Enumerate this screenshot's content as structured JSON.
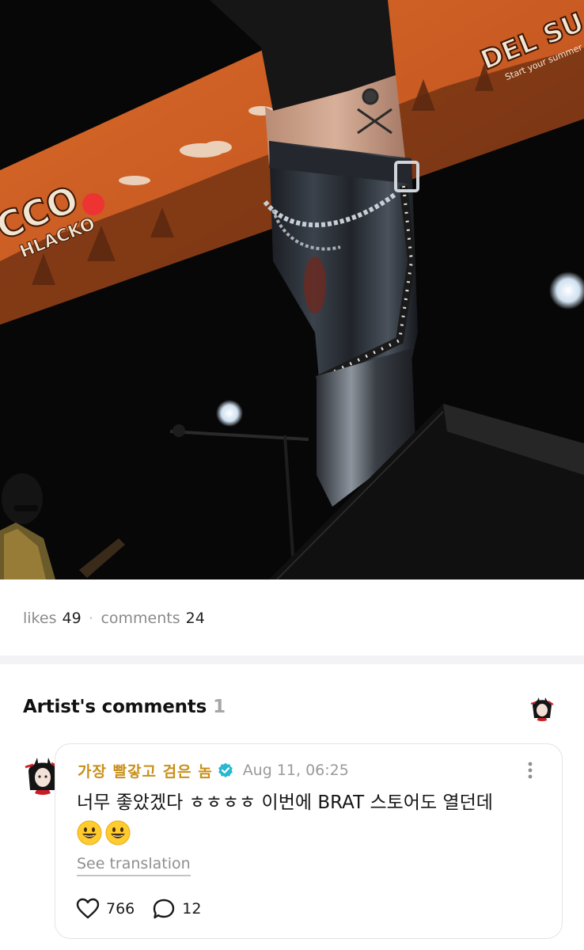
{
  "stats": {
    "likes_label": "likes",
    "likes_count": "49",
    "separator": "·",
    "comments_label": "comments",
    "comments_count": "24"
  },
  "artist_comments": {
    "title": "Artist's comments",
    "count": "1"
  },
  "comment": {
    "author": "가장 빨갛고 검은 놈",
    "verified_icon": "verified-badge-icon",
    "date": "Aug 11, 06:25",
    "text": "너무 좋았겠다 ㅎㅎㅎㅎ 이번에 BRAT 스토어도 열던데",
    "emojis": [
      "smiley-emoji",
      "smiley-emoji"
    ],
    "see_translation": "See translation",
    "like_count": "766",
    "reply_count": "12"
  },
  "photo": {
    "banner_text_left": "CCO",
    "banner_text_left_sub": "HLACKO",
    "banner_text_right": "DEL SU",
    "banner_text_right_sub": "Start your summer"
  },
  "colors": {
    "author": "#c8901a",
    "verified": "#2ab7cf",
    "muted": "#8a8a8a"
  }
}
